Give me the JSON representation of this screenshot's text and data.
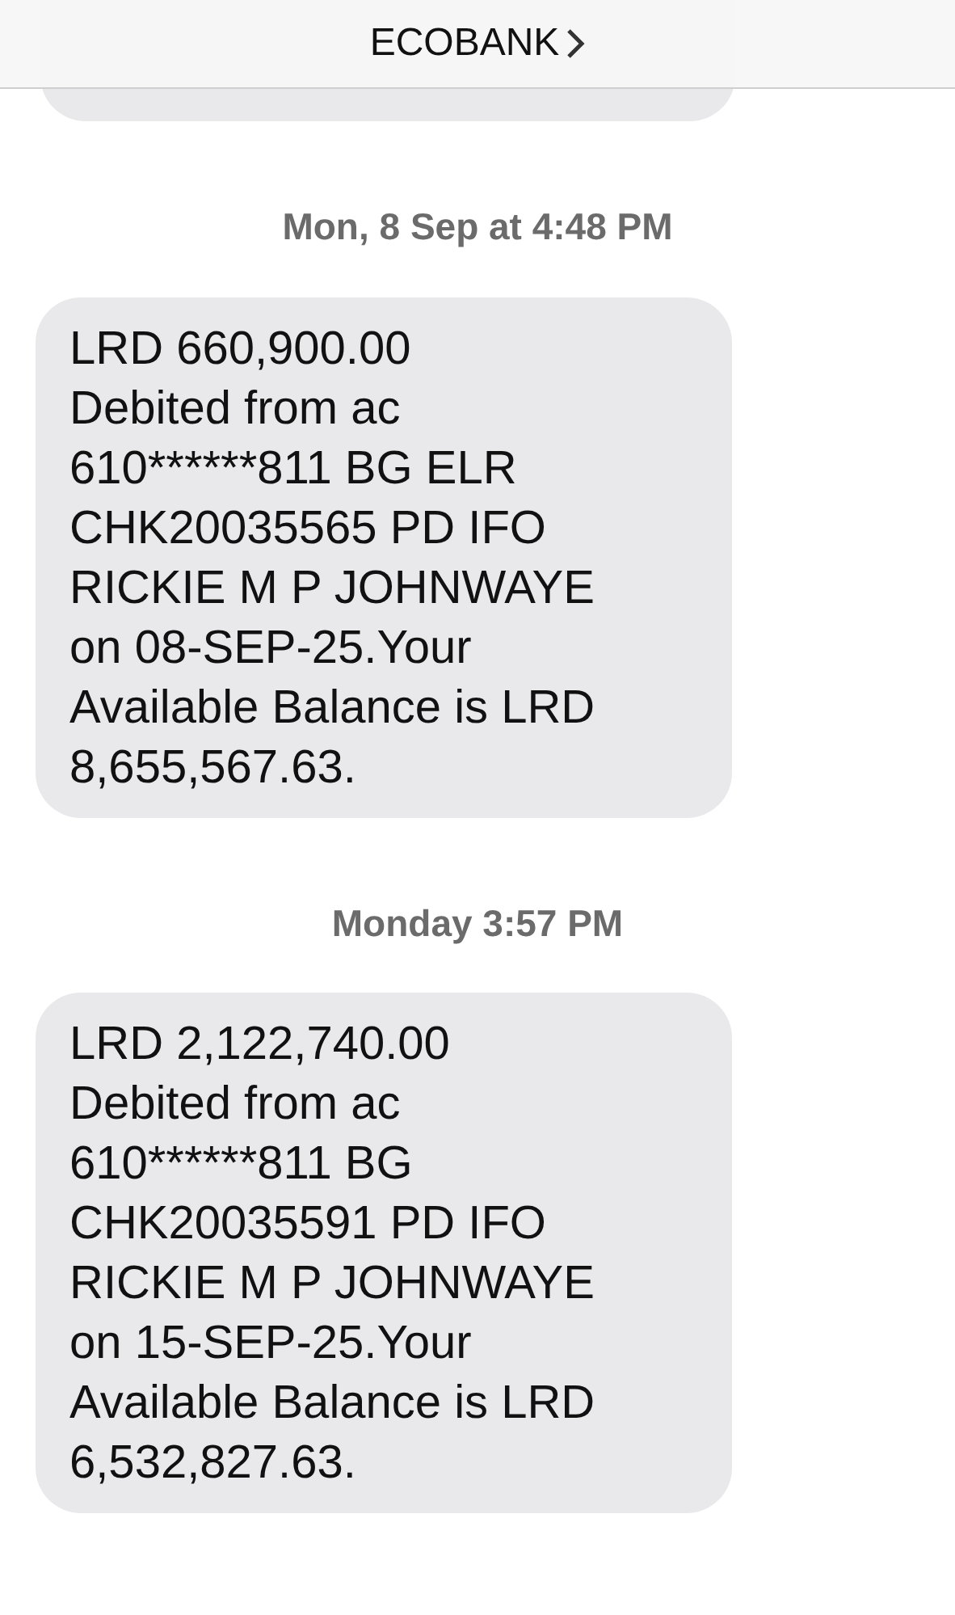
{
  "header": {
    "title": "ECOBANK"
  },
  "messages": [
    {
      "kind": "timestamp",
      "text": "Mon, 8 Sep at 4:48 PM"
    },
    {
      "kind": "bubble",
      "lines": [
        "LRD 660,900.00",
        "Debited from ac",
        "610******811 BG ELR",
        "CHK20035565 PD IFO",
        "RICKIE M P JOHNWAYE",
        "on 08-SEP-25.Your",
        "Available Balance is LRD",
        "8,655,567.63."
      ]
    },
    {
      "kind": "timestamp",
      "text": "Monday 3:57 PM"
    },
    {
      "kind": "bubble",
      "lines": [
        "LRD 2,122,740.00",
        "Debited from ac",
        "610******811 BG",
        "CHK20035591 PD IFO",
        "RICKIE M P JOHNWAYE",
        "on 15-SEP-25.Your",
        "Available Balance is LRD",
        "6,532,827.63."
      ]
    }
  ]
}
